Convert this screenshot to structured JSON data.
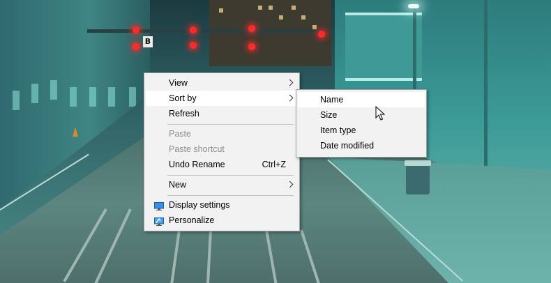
{
  "context_menu": {
    "items": [
      {
        "label": "View",
        "submenu": true
      },
      {
        "label": "Sort by",
        "submenu": true,
        "highlighted": true
      },
      {
        "label": "Refresh"
      },
      {
        "label": "Paste",
        "disabled": true
      },
      {
        "label": "Paste shortcut",
        "disabled": true
      },
      {
        "label": "Undo Rename",
        "shortcut": "Ctrl+Z"
      },
      {
        "label": "New",
        "submenu": true
      },
      {
        "label": "Display settings",
        "icon": "display-settings-icon"
      },
      {
        "label": "Personalize",
        "icon": "personalize-icon"
      }
    ]
  },
  "sort_submenu": {
    "items": [
      {
        "label": "Name",
        "highlighted": true
      },
      {
        "label": "Size"
      },
      {
        "label": "Item type"
      },
      {
        "label": "Date modified"
      }
    ]
  },
  "wallpaper": {
    "sign_letter": "B"
  },
  "colors": {
    "menu_background": "#f2f2f2",
    "disabled_text": "#8d8d8d",
    "highlight": "#ffffff"
  }
}
